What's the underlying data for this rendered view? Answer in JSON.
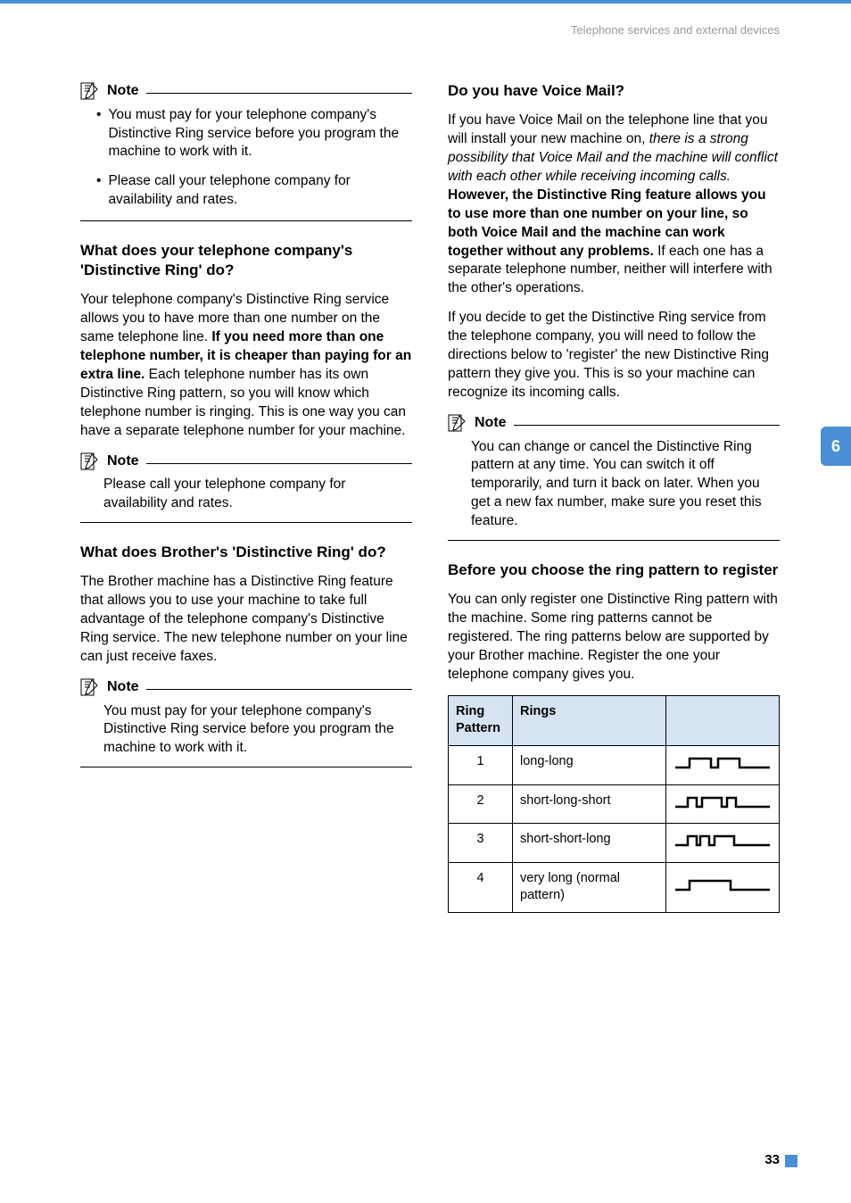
{
  "header": {
    "running_title": "Telephone services and external devices"
  },
  "chapter": {
    "number": "6"
  },
  "page": {
    "number": "33"
  },
  "left": {
    "note1": {
      "label": "Note",
      "bullet1": "You must pay for your telephone company's Distinctive Ring service before you program the machine to work with it.",
      "bullet2": "Please call your telephone company for availability and rates."
    },
    "h1": "What does your telephone company's 'Distinctive Ring' do?",
    "p1a": "Your telephone company's Distinctive Ring service allows you to have more than one number on the same telephone line. ",
    "p1b": "If you need more than one telephone number, it is cheaper than paying for an extra line.",
    "p1c": " Each telephone number has its own Distinctive Ring pattern, so you will know which telephone number is ringing. This is one way you can have a separate telephone number for your machine.",
    "note2": {
      "label": "Note",
      "body": "Please call your telephone company for availability and rates."
    },
    "h2": "What does Brother's 'Distinctive Ring' do?",
    "p2": "The Brother machine has a Distinctive Ring feature that allows you to use your machine to take full advantage of the telephone company's Distinctive Ring service. The new telephone number on your line can just receive faxes.",
    "note3": {
      "label": "Note",
      "body": "You must pay for your telephone company's Distinctive Ring service before you program the machine to work with it."
    }
  },
  "right": {
    "h1": "Do you have Voice Mail?",
    "p1a": "If you have Voice Mail on the telephone line that you will install your new machine on, ",
    "p1b": "there is a strong possibility that Voice Mail and the machine will conflict with each other while receiving incoming calls.",
    "p1c": " However, the Distinctive Ring feature allows you to use more than one number on your line, so both Voice Mail and the machine can work together without any problems.",
    "p1d": " If each one has a separate telephone number, neither will interfere with the other's operations.",
    "p2": "If you decide to get the Distinctive Ring service from the telephone company, you will need to follow the directions below to 'register' the new Distinctive Ring pattern they give you. This is so your machine can recognize its incoming calls.",
    "note1": {
      "label": "Note",
      "body": "You can change or cancel the Distinctive Ring pattern at any time. You can switch it off temporarily, and turn it back on later. When you get a new fax number, make sure you reset this feature."
    },
    "h2": "Before you choose the ring pattern to register",
    "p3": "You can only register one Distinctive Ring pattern with the machine. Some ring patterns cannot be registered. The ring patterns below are supported by your Brother machine. Register the one your telephone company gives you.",
    "table": {
      "col1": "Ring Pattern",
      "col2": "Rings",
      "rows": [
        {
          "pattern": "1",
          "rings": "long-long"
        },
        {
          "pattern": "2",
          "rings": "short-long-short"
        },
        {
          "pattern": "3",
          "rings": "short-short-long"
        },
        {
          "pattern": "4",
          "rings": "very long (normal pattern)"
        }
      ]
    }
  }
}
